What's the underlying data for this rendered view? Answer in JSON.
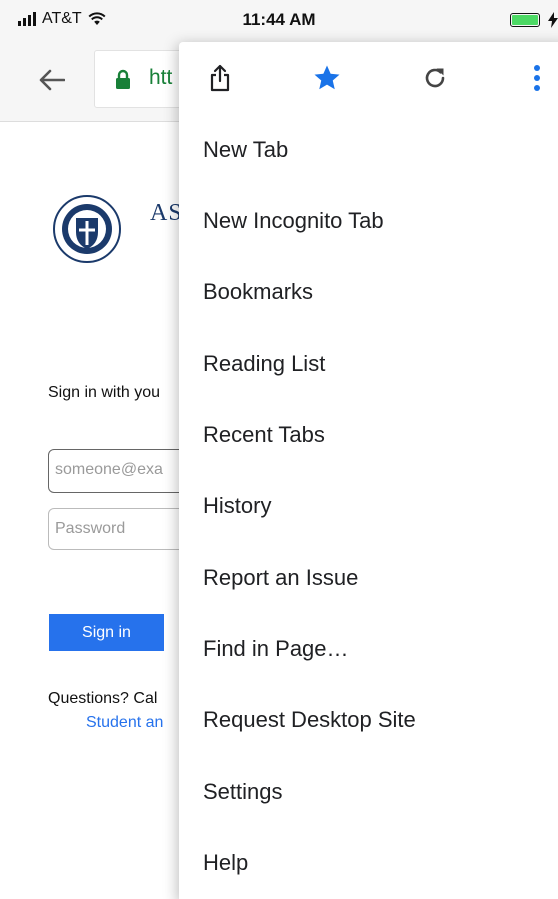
{
  "status_bar": {
    "carrier": "AT&T",
    "time": "11:44 AM",
    "icons": [
      "signal-icon",
      "wifi-icon",
      "battery-icon",
      "charging-icon"
    ]
  },
  "toolbar": {
    "url_text": "htt",
    "icons": [
      "back-arrow-icon",
      "lock-icon"
    ]
  },
  "page": {
    "college_name": "AS",
    "sign_in_prompt": "Sign in with you",
    "email_placeholder": "someone@exa",
    "password_placeholder": "Password",
    "sign_in_label": "Sign in",
    "questions_text": "Questions? Cal",
    "support_link": "Student an"
  },
  "menu": {
    "top_icons": [
      "share-icon",
      "star-icon",
      "reload-icon",
      "more-vertical-icon"
    ],
    "items": [
      {
        "label": "New Tab"
      },
      {
        "label": "New Incognito Tab"
      },
      {
        "label": "Bookmarks"
      },
      {
        "label": "Reading List"
      },
      {
        "label": "Recent Tabs"
      },
      {
        "label": "History"
      },
      {
        "label": "Report an Issue"
      },
      {
        "label": "Find in Page…"
      },
      {
        "label": "Request Desktop Site"
      },
      {
        "label": "Settings"
      },
      {
        "label": "Help"
      }
    ]
  },
  "colors": {
    "accent_blue": "#1a73e8",
    "lock_green": "#188038",
    "battery_green": "#4cd964",
    "sign_in_blue": "#2672ec"
  }
}
